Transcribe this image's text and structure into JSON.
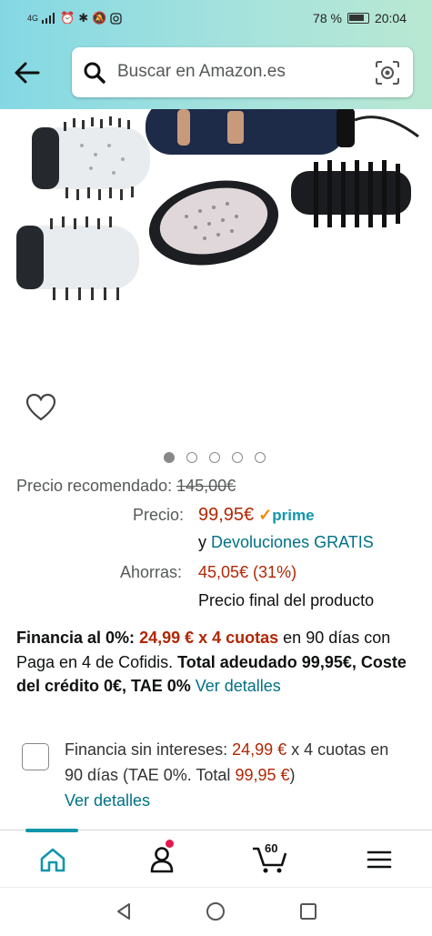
{
  "status_bar": {
    "network": "4G",
    "battery": "78 %",
    "time": "20:04"
  },
  "search": {
    "placeholder": "Buscar en Amazon.es"
  },
  "gallery": {
    "image_count": 5,
    "active_index": 0
  },
  "pricing": {
    "recommended_label": "Precio recomendado:",
    "recommended_value": "145,00€",
    "price_label": "Precio:",
    "price_value": "99,95€",
    "prime_label": "prime",
    "returns_prefix": "y",
    "returns_link": "Devoluciones GRATIS",
    "savings_label": "Ahorras:",
    "savings_value": "45,05€ (31%)",
    "final_note": "Precio final del producto"
  },
  "financing": {
    "p1": "Financia al 0%:",
    "p2": "24,99 € x 4 cuotas",
    "p3": " en 90 días con Paga en 4 de Cofidis. ",
    "p4": "Total adeudado 99,95€, Coste del crédito 0€, TAE 0%",
    "p5": " ",
    "link": "Ver detalles"
  },
  "financing_option": {
    "t1": "Financia sin intereses: ",
    "t2": "24,99 €",
    "t3": " x 4 cuotas en 90 días (TAE 0%. Total ",
    "t4": "99,95 €",
    "t5": ")",
    "link": "Ver detalles"
  },
  "tabbar": {
    "cart_count": "60"
  },
  "colors": {
    "accent": "#1196ab",
    "price_red": "#b12704",
    "link": "#007185"
  }
}
